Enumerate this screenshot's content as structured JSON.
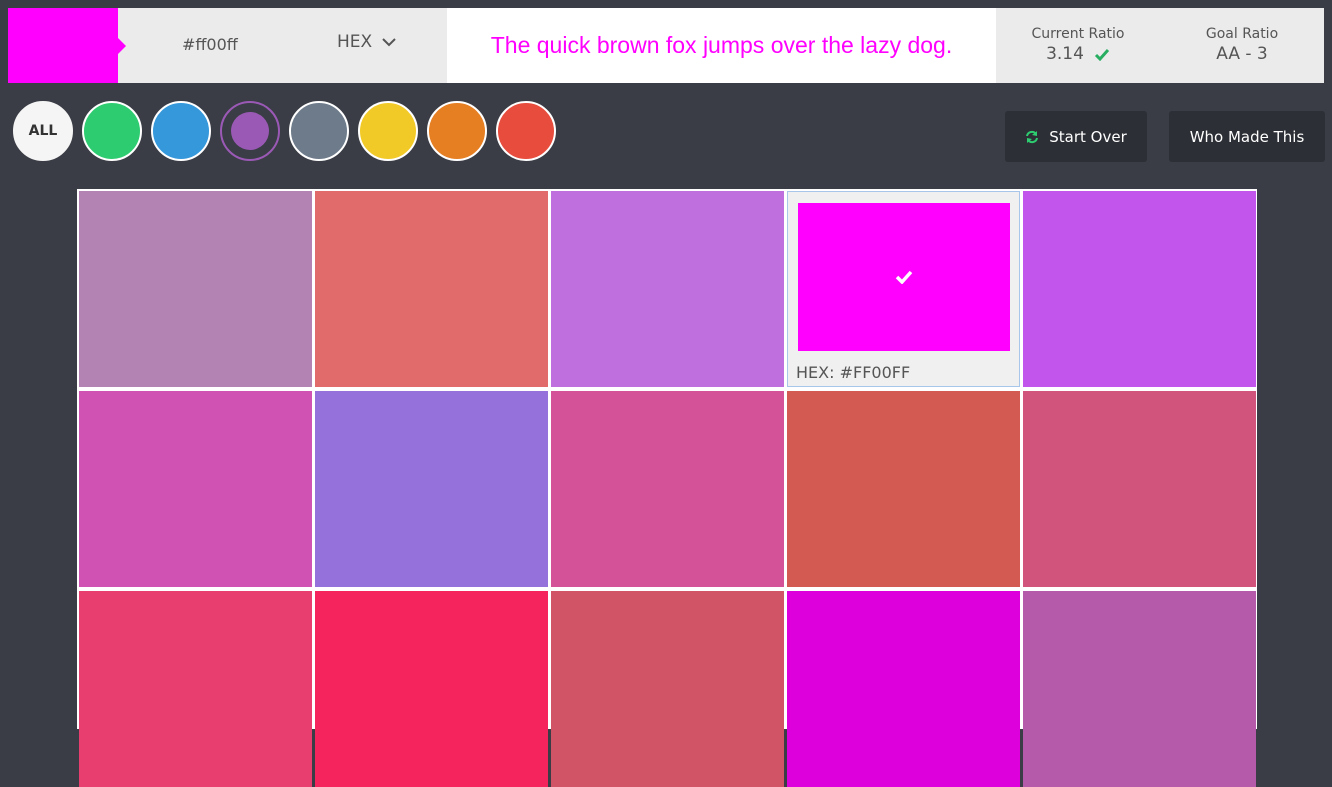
{
  "header": {
    "swatch_color": "#ff00ff",
    "hex_value": "#ff00ff",
    "format": "HEX",
    "sample_text": "The quick brown fox jumps over the lazy dog.",
    "current_ratio_label": "Current Ratio",
    "current_ratio_value": "3.14",
    "goal_ratio_label": "Goal Ratio",
    "goal_ratio_value": "AA - 3"
  },
  "filters": {
    "all_label": "ALL",
    "colors": [
      "#2ecc71",
      "#3498db",
      "#9b59b6",
      "#6e7b8b",
      "#f2ca27",
      "#e67e22",
      "#e74c3c"
    ],
    "selected": "purple"
  },
  "buttons": {
    "start_over": "Start Over",
    "who_made_this": "Who Made This"
  },
  "grid": {
    "rows": [
      [
        "#b384b3",
        "#e16b6b",
        "#c06fdf",
        "#ff00ff",
        "#c155ec"
      ],
      [
        "#d052b2",
        "#9571db",
        "#d35298",
        "#d35a52",
        "#d0547b"
      ],
      [
        "#e83e6f",
        "#f5245c",
        "#d05465",
        "#dd00dd",
        "#b55aaa"
      ]
    ],
    "selected": {
      "row": 0,
      "col": 3,
      "caption": "HEX: #FF00FF"
    }
  }
}
